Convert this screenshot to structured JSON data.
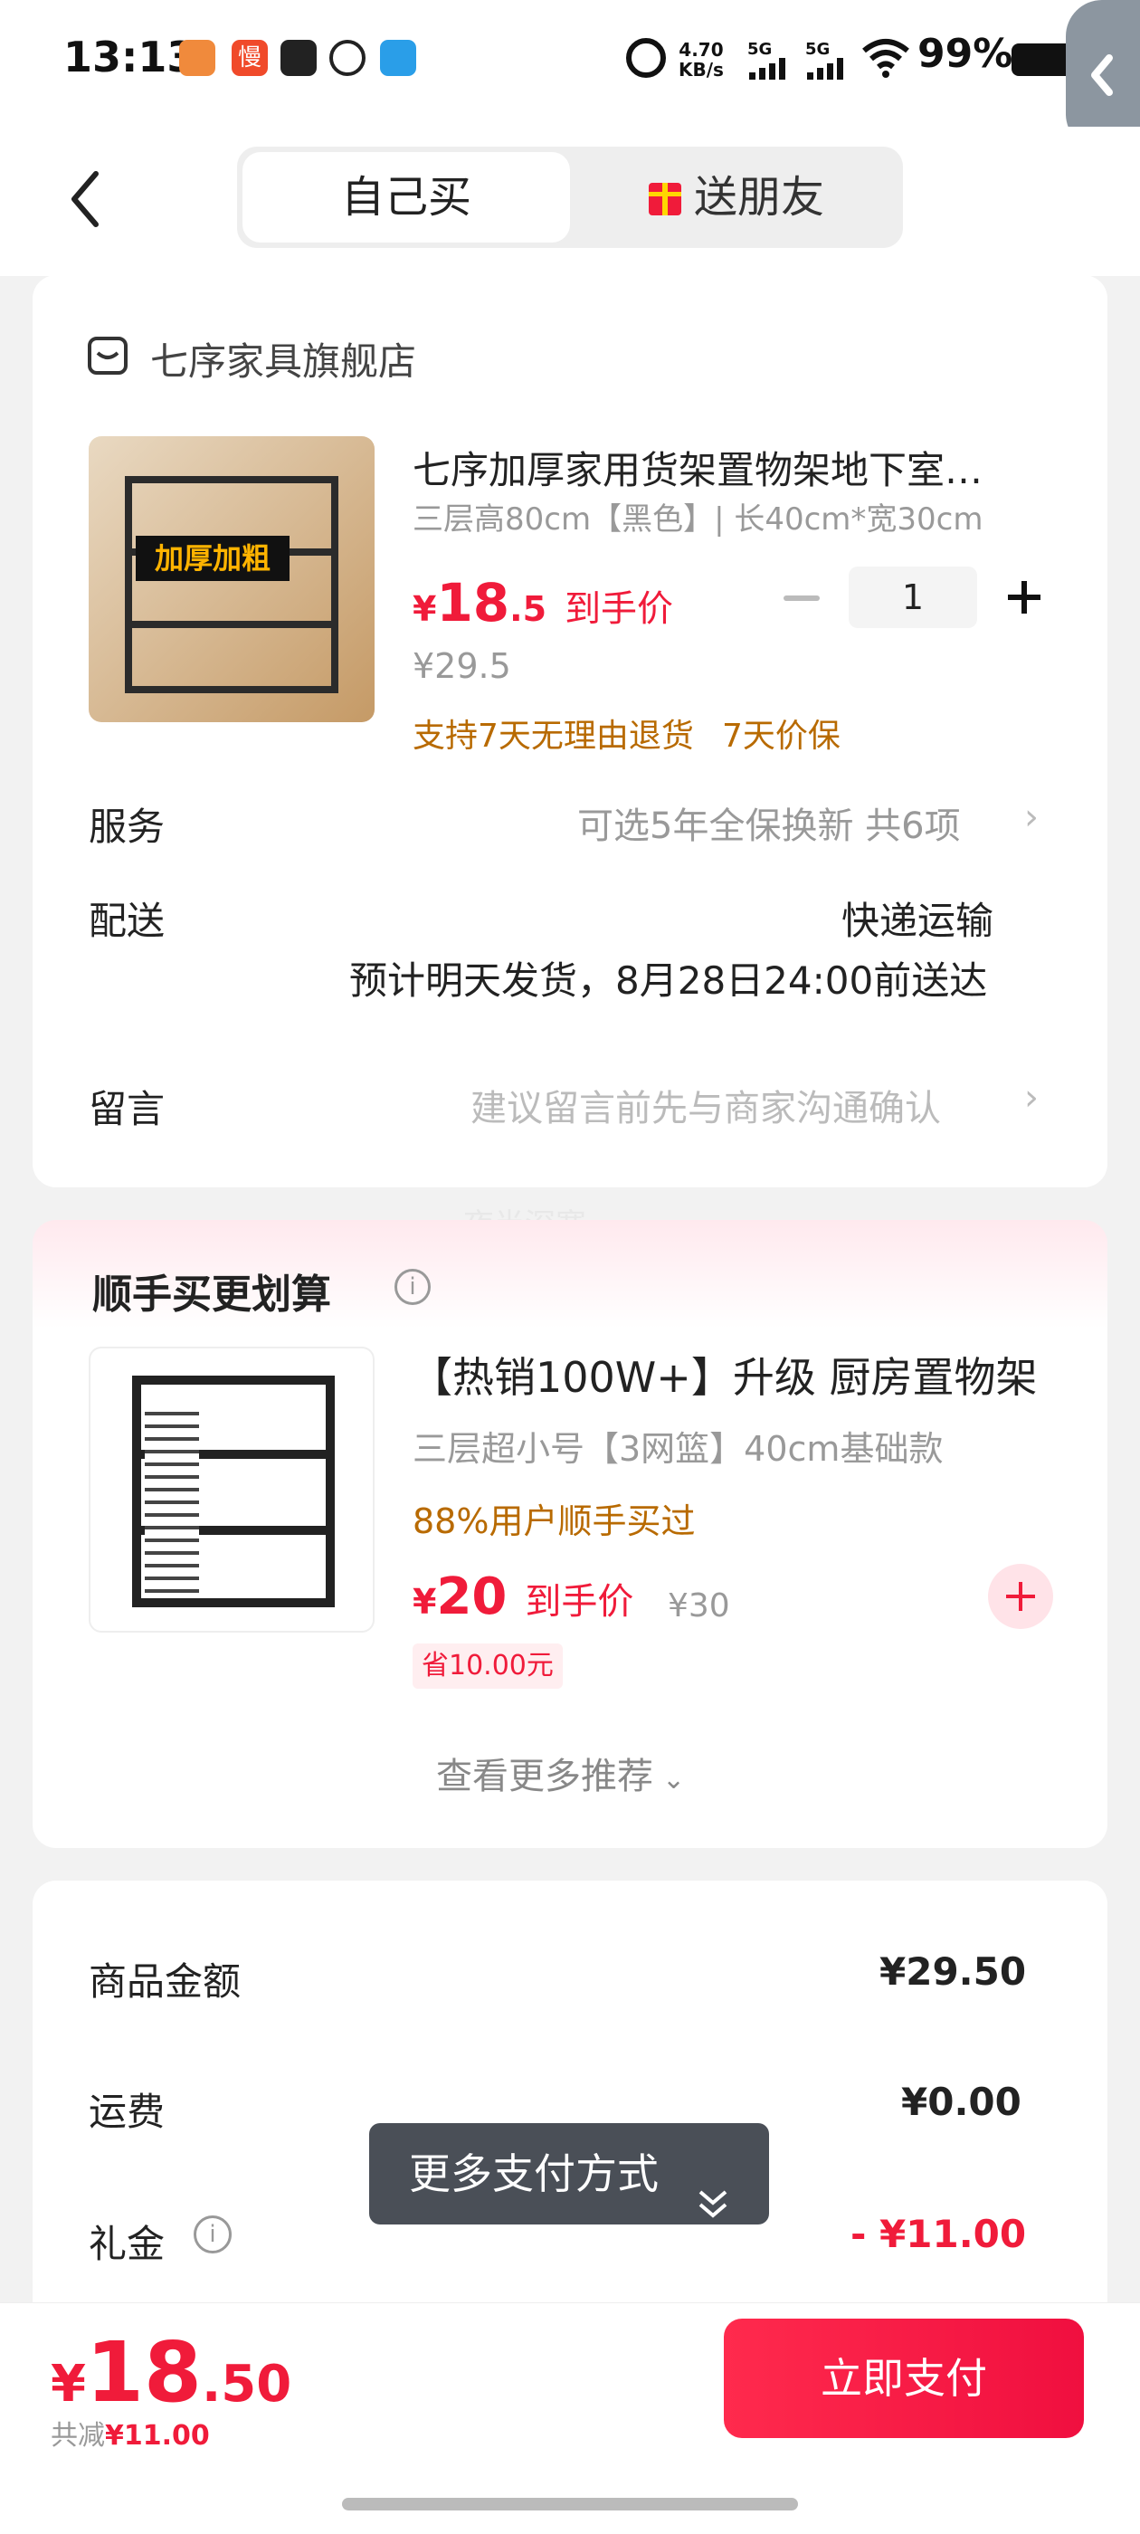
{
  "status_bar": {
    "time": "13:13",
    "net_speed": "4.70",
    "net_unit": "KB/s",
    "sim1": "5G",
    "sim2": "5G",
    "battery": "99%"
  },
  "header": {
    "tab_self": "自己买",
    "tab_gift": "送朋友"
  },
  "order": {
    "shop_name": "七序家具旗舰店",
    "product_title": "七序加厚家用货架置物架地下室…",
    "product_spec": "三层高80cm【黑色】| 长40cm*宽30cm",
    "image_text": "加厚加粗",
    "price_symbol": "¥",
    "price_int": "18",
    "price_dec": ".5",
    "price_label": "到手价",
    "original_price": "¥29.5",
    "quantity": "1",
    "guarantee_1": "支持7天无理由退货",
    "guarantee_2": "7天价保",
    "service_label": "服务",
    "service_value": "可选5年全保换新 共6项",
    "delivery_label": "配送",
    "delivery_method": "快递运输",
    "delivery_eta": "预计明天发货，8月28日24:00前送达",
    "note_label": "留言",
    "note_placeholder": "建议留言前先与商家沟通确认",
    "watermark": "夜半深寒"
  },
  "addon": {
    "section_title": "顺手买更划算",
    "product_title": "【热销100W+】升级 厨房置物架",
    "product_spec": "三层超小号【3网篮】40cm基础款",
    "social_proof": "88%用户顺手买过",
    "price_symbol": "¥",
    "price": "20",
    "price_label": "到手价",
    "original_price": "¥30",
    "save_badge": "省10.00元",
    "more_link": "查看更多推荐"
  },
  "summary": {
    "goods_label": "商品金额",
    "goods_value": "¥29.50",
    "shipping_label": "运费",
    "shipping_value": "¥0.00",
    "gift_label": "礼金",
    "gift_value": "- ¥11.00"
  },
  "toast": {
    "label": "更多支付方式"
  },
  "bottom": {
    "price_symbol": "¥",
    "total_int": "18",
    "total_dec": ".50",
    "discount_label": "共减",
    "discount_value": "¥11.00",
    "pay_button": "立即支付"
  },
  "colors": {
    "accent_red": "#f01b3a",
    "guarantee_orange": "#b86a00",
    "toast_bg": "#4a4f57"
  }
}
